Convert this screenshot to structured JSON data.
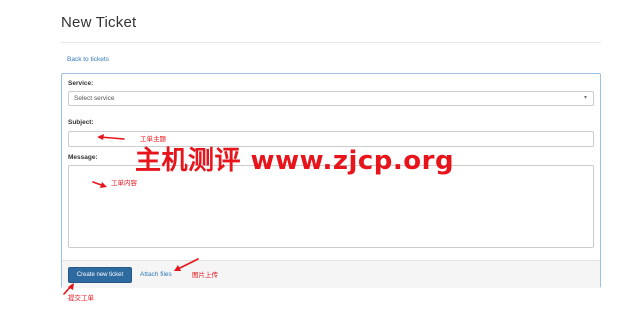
{
  "page": {
    "title": "New Ticket"
  },
  "nav": {
    "back_link": "Back to tickets"
  },
  "form": {
    "service": {
      "label": "Service:",
      "value": "Select service"
    },
    "subject": {
      "label": "Subject:",
      "value": ""
    },
    "message": {
      "label": "Message:",
      "value": ""
    }
  },
  "actions": {
    "submit_label": "Create new ticket",
    "attach_label": "Attach files"
  },
  "watermark": {
    "text": "主机测评 www.zjcp.org"
  },
  "annotations": {
    "subject_note": "工单主题",
    "message_note": "工单内容",
    "attach_note": "图片上传",
    "submit_note": "提交工单"
  },
  "colors": {
    "accent": "#337ab7",
    "primary_button": "#2d6a9f",
    "annotation": "#e8141b"
  }
}
